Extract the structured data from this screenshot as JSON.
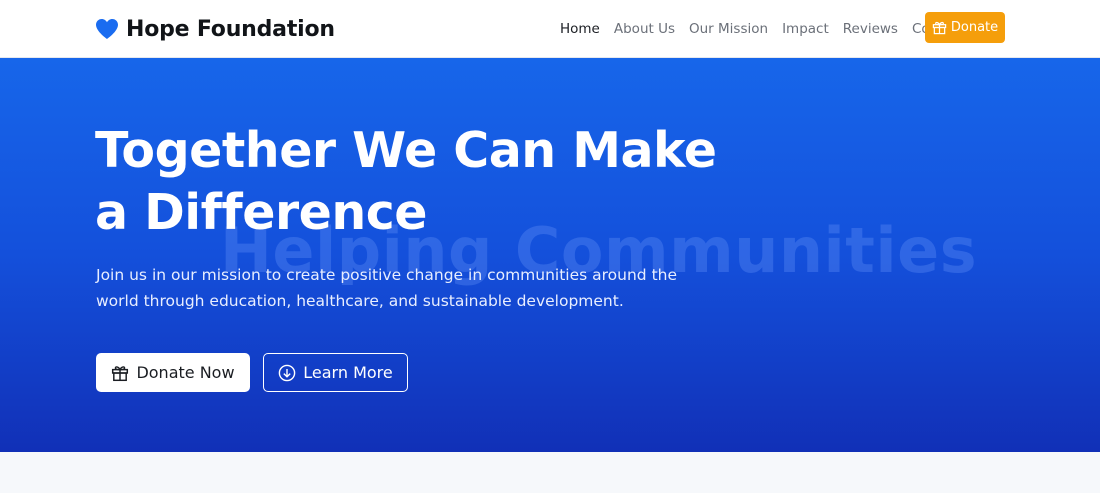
{
  "brand": {
    "name": "Hope Foundation",
    "icon": "heart-icon",
    "color": "#1a6cf0"
  },
  "nav": {
    "links": [
      {
        "label": "Home",
        "active": true
      },
      {
        "label": "About Us",
        "active": false
      },
      {
        "label": "Our Mission",
        "active": false
      },
      {
        "label": "Impact",
        "active": false
      },
      {
        "label": "Reviews",
        "active": false
      },
      {
        "label": "Contact",
        "active": false
      }
    ],
    "donate_label": "Donate",
    "donate_icon": "gift-icon",
    "donate_color": "#f59e0b"
  },
  "hero": {
    "title": "Together We Can Make a Difference",
    "watermark": "Helping Communities",
    "subtitle": "Join us in our mission to create positive change in communities around the world through education, healthcare, and sustainable development.",
    "primary_button": {
      "label": "Donate Now",
      "icon": "gift-icon"
    },
    "secondary_button": {
      "label": "Learn More",
      "icon": "arrow-down-circle-icon"
    },
    "gradient_colors": [
      "#1766ea",
      "#1130b7"
    ]
  }
}
